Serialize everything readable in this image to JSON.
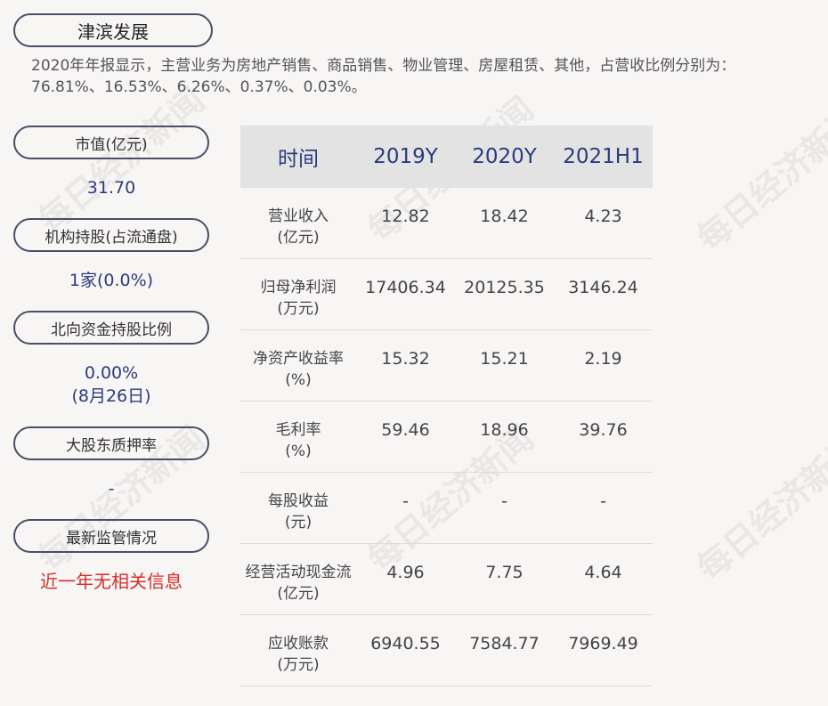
{
  "company": "津滨发展",
  "summary": "2020年年报显示，主营业务为房地产销售、商品销售、物业管理、房屋租赁、其他，占营收比例分别为：76.81%、16.53%、6.26%、0.37%、0.03%。",
  "sidebar": {
    "market_cap": {
      "label": "市值(亿元)",
      "value": "31.70"
    },
    "institution": {
      "label": "机构持股(占流通盘)",
      "value": "1家(0.0%)"
    },
    "northbound": {
      "label": "北向资金持股比例",
      "value": "0.00%",
      "date": "(8月26日)"
    },
    "pledge": {
      "label": "大股东质押率",
      "value": "-"
    },
    "regulation": {
      "label": "最新监管情况",
      "value": "近一年无相关信息"
    }
  },
  "table": {
    "headers": [
      "时间",
      "2019Y",
      "2020Y",
      "2021H1"
    ],
    "rows": [
      {
        "name": "营业收入",
        "unit": "(亿元)",
        "values": [
          "12.82",
          "18.42",
          "4.23"
        ]
      },
      {
        "name": "归母净利润",
        "unit": "(万元)",
        "values": [
          "17406.34",
          "20125.35",
          "3146.24"
        ]
      },
      {
        "name": "净资产收益率",
        "unit": "(%)",
        "values": [
          "15.32",
          "15.21",
          "2.19"
        ]
      },
      {
        "name": "毛利率",
        "unit": "(%)",
        "values": [
          "59.46",
          "18.96",
          "39.76"
        ]
      },
      {
        "name": "每股收益",
        "unit": "(元)",
        "values": [
          "-",
          "-",
          "-"
        ]
      },
      {
        "name": "经营活动现金流",
        "unit": "(亿元)",
        "values": [
          "4.96",
          "7.75",
          "4.64"
        ]
      },
      {
        "name": "应收账款",
        "unit": "(万元)",
        "values": [
          "6940.55",
          "7584.77",
          "7969.49"
        ]
      }
    ]
  },
  "watermark": "每日经济新闻"
}
